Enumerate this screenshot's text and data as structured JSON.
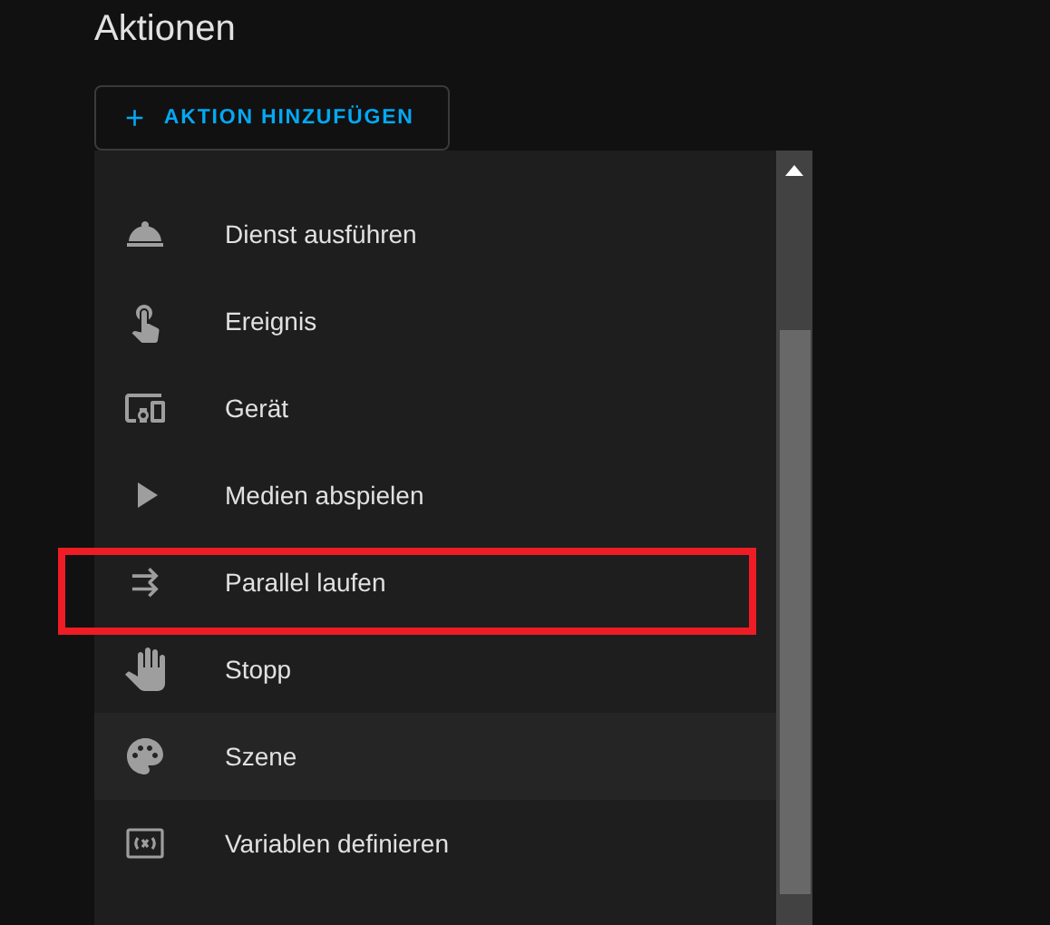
{
  "header": {
    "title": "Aktionen"
  },
  "add_button": {
    "icon": "+",
    "label": "AKTION HINZUFÜGEN"
  },
  "menu": {
    "items": [
      {
        "label": "Dienst ausführen",
        "hovered": false,
        "annotated": false
      },
      {
        "label": "Ereignis",
        "hovered": false,
        "annotated": false
      },
      {
        "label": "Gerät",
        "hovered": false,
        "annotated": false
      },
      {
        "label": "Medien abspielen",
        "hovered": false,
        "annotated": false
      },
      {
        "label": "Parallel laufen",
        "hovered": false,
        "annotated": true
      },
      {
        "label": "Stopp",
        "hovered": false,
        "annotated": false
      },
      {
        "label": "Szene",
        "hovered": true,
        "annotated": false
      },
      {
        "label": "Variablen definieren",
        "hovered": false,
        "annotated": false
      }
    ]
  }
}
